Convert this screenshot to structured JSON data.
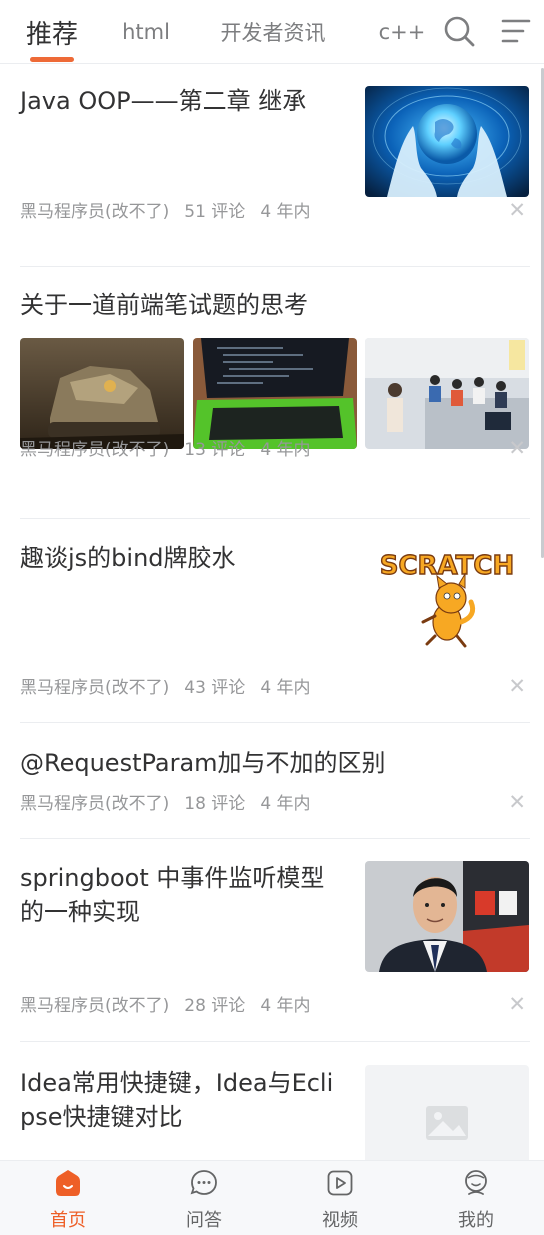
{
  "tabs": [
    "推荐",
    "html",
    "开发者资讯",
    "c++"
  ],
  "articles": [
    {
      "title": "Java OOP——第二章 继承",
      "author": "黑马程序员(改不了)",
      "comments": "51 评论",
      "time": "4 年内"
    },
    {
      "title": "关于一道前端笔试题的思考",
      "author": "黑马程序员(改不了)",
      "comments": "13 评论",
      "time": "4 年内"
    },
    {
      "title": "趣谈js的bind牌胶水",
      "author": "黑马程序员(改不了)",
      "comments": "43 评论",
      "time": "4 年内"
    },
    {
      "title": "@RequestParam加与不加的区别",
      "author": "黑马程序员(改不了)",
      "comments": "18 评论",
      "time": "4 年内"
    },
    {
      "title": "springboot 中事件监听模型的一种实现",
      "author": "黑马程序员(改不了)",
      "comments": "28 评论",
      "time": "4 年内"
    },
    {
      "title": "Idea常用快捷键，Idea与Eclipse快捷键对比"
    }
  ],
  "scratch_logo": "SCRATCH",
  "nav": {
    "items": [
      {
        "label": "首页",
        "icon": "home-icon"
      },
      {
        "label": "问答",
        "icon": "chat-icon"
      },
      {
        "label": "视频",
        "icon": "video-icon"
      },
      {
        "label": "我的",
        "icon": "user-icon"
      }
    ],
    "active_color": "#ee5f27"
  },
  "colors": {
    "accent": "#ee6a37",
    "meta": "#969799",
    "title": "#323233"
  }
}
